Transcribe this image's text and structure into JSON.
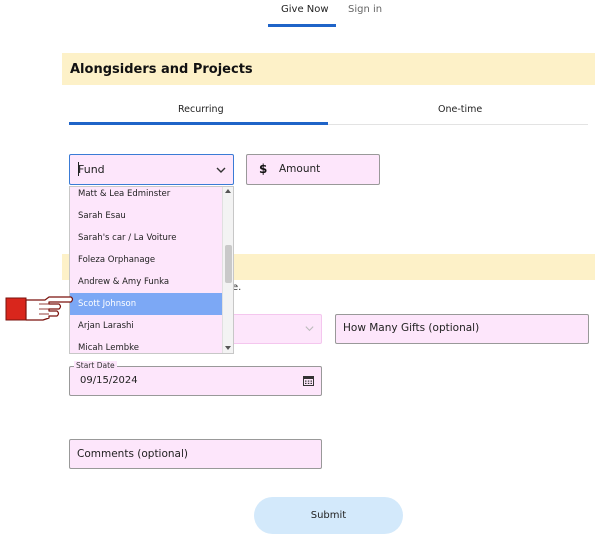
{
  "nav": {
    "tabs": [
      {
        "label": "Give Now",
        "active": true
      },
      {
        "label": "Sign in",
        "active": false
      }
    ]
  },
  "section": {
    "title": "Alongsiders and Projects"
  },
  "frequency_tabs": [
    {
      "label": "Recurring",
      "active": true
    },
    {
      "label": "One-time",
      "active": false
    }
  ],
  "fund_select": {
    "value": "Fund",
    "icon": "chevron-down-icon"
  },
  "amount": {
    "symbol": "$",
    "placeholder": "Amount"
  },
  "fund_options": [
    {
      "label": "Matt & Lea Edminster",
      "selected": false
    },
    {
      "label": "Sarah Esau",
      "selected": false
    },
    {
      "label": "Sarah's car / La Voiture",
      "selected": false
    },
    {
      "label": "Foleza Orphanage",
      "selected": false
    },
    {
      "label": "Andrew & Amy Funka",
      "selected": false
    },
    {
      "label": "Scott Johnson",
      "selected": true
    },
    {
      "label": "Arjan Larashi",
      "selected": false
    },
    {
      "label": "Micah Lembke",
      "selected": false
    }
  ],
  "partial_hint": "e.",
  "how_many_gifts": {
    "placeholder": "How Many Gifts  (optional)"
  },
  "start_date": {
    "label": "Start Date",
    "value": "09/15/2024",
    "icon": "calendar-icon"
  },
  "comments": {
    "placeholder": "Comments  (optional)"
  },
  "submit": {
    "label": "Submit"
  },
  "colors": {
    "accent": "#1f64c8",
    "field_bg": "#fde6fb",
    "section_bg": "#fdf1c8",
    "selected_option": "#7ca8f5",
    "submit_bg": "#d3e9fb",
    "pointer": "#d9261c"
  }
}
